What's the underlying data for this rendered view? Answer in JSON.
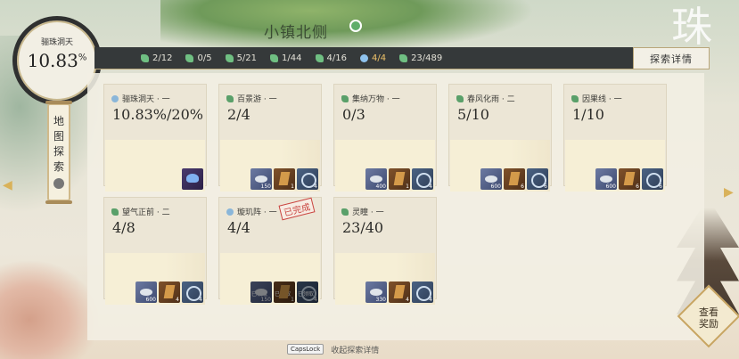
{
  "map": {
    "title": "小镇北侧"
  },
  "badge": {
    "name": "骊珠洞天",
    "value": "10.83",
    "unit": "%"
  },
  "background": {
    "big_char": "珠"
  },
  "stats": [
    {
      "icon": "leaf-icon",
      "value": "2/12"
    },
    {
      "icon": "leaf-icon",
      "value": "0/5"
    },
    {
      "icon": "leaf-icon",
      "value": "5/21"
    },
    {
      "icon": "leaf-icon",
      "value": "1/44"
    },
    {
      "icon": "leaf-icon",
      "value": "4/16"
    },
    {
      "icon": "orb-icon",
      "value": "4/4"
    },
    {
      "icon": "leaf-icon",
      "value": "23/489"
    }
  ],
  "explore_button": "探索详情",
  "scroll": {
    "chars": [
      "地",
      "图",
      "探",
      "索"
    ]
  },
  "cards": [
    {
      "name": "骊珠洞天 · 一",
      "value": "10.83%/20%",
      "rewards": [
        {
          "type": "gem",
          "count": ""
        }
      ]
    },
    {
      "name": "百景游 · 一",
      "value": "2/4",
      "rewards": [
        {
          "type": "silver",
          "count": "150"
        },
        {
          "type": "book",
          "count": "1"
        },
        {
          "type": "coin",
          "count": "4"
        }
      ]
    },
    {
      "name": "集纳万物 · 一",
      "value": "0/3",
      "rewards": [
        {
          "type": "silver",
          "count": "400"
        },
        {
          "type": "book",
          "count": "1"
        },
        {
          "type": "coin",
          "count": "4"
        }
      ]
    },
    {
      "name": "春风化雨 · 二",
      "value": "5/10",
      "rewards": [
        {
          "type": "silver",
          "count": "600"
        },
        {
          "type": "book",
          "count": "6"
        },
        {
          "type": "coin",
          "count": "6"
        }
      ]
    },
    {
      "name": "因果线 · 一",
      "value": "1/10",
      "rewards": [
        {
          "type": "silver",
          "count": "600"
        },
        {
          "type": "book",
          "count": "6"
        },
        {
          "type": "coin",
          "count": "6"
        }
      ]
    },
    {
      "name": "望气正前 · 二",
      "value": "4/8",
      "rewards": [
        {
          "type": "silver",
          "count": "600"
        },
        {
          "type": "book",
          "count": "4"
        },
        {
          "type": "coin",
          "count": "4"
        }
      ]
    },
    {
      "name": "璇玑阵 · 一",
      "value": "4/4",
      "stamp": "已完成",
      "rewards": [
        {
          "type": "silver",
          "count": "150",
          "got": "已领取"
        },
        {
          "type": "book",
          "count": "1",
          "got": "已领取"
        },
        {
          "type": "coin",
          "count": "4",
          "got": "已领取"
        }
      ]
    },
    {
      "name": "灵瞳 · 一",
      "value": "23/40",
      "rewards": [
        {
          "type": "silver",
          "count": "330"
        },
        {
          "type": "book",
          "count": "4"
        },
        {
          "type": "coin",
          "count": "4"
        }
      ]
    }
  ],
  "footer": {
    "key": "CapsLock",
    "label": "收起探索详情"
  },
  "reward_button": {
    "line1": "查看",
    "line2": "奖励"
  }
}
